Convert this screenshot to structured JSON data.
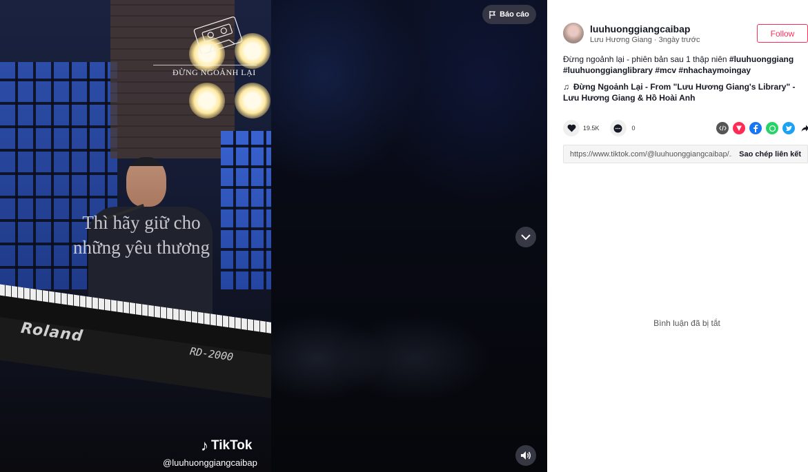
{
  "video": {
    "report_label": "Báo cáo",
    "song_logo_text": "ĐỪNG NGOẢNH LẠI",
    "lyric_line1": "Thì hãy giữ cho",
    "lyric_line2": "những yêu thương",
    "brand_keyboard": "Roland",
    "keyboard_model": "RD-2000",
    "watermark_brand": "TikTok",
    "watermark_handle": "@luuhuonggiangcaibap",
    "icons": [
      "flag-icon",
      "chevron-down-icon",
      "volume-icon",
      "tiktok-note-icon"
    ]
  },
  "author": {
    "username": "luuhuonggiangcaibap",
    "display_name": "Lưu Hương Giang",
    "separator": "·",
    "posted": "3ngày trước",
    "follow_label": "Follow"
  },
  "caption": {
    "text": "Đừng ngoảnh lại - phiên bản sau 1 thập niên ",
    "tags": [
      "#luuhuonggiang",
      "#luuhuonggianglibrary",
      "#mcv",
      "#nhachaymoingay"
    ]
  },
  "music": {
    "title": "Đừng Ngoảnh Lại - From \"Lưu Hương Giang's Library\" - Lưu Hương Giang & Hồ Hoài Anh"
  },
  "stats": {
    "likes": "19.5K",
    "comments": "0"
  },
  "share": {
    "icons": [
      "embed-icon",
      "send-icon",
      "facebook-icon",
      "whatsapp-icon",
      "twitter-icon",
      "share-arrow-icon"
    ]
  },
  "link": {
    "url": "https://www.tiktok.com/@luuhuonggiangcaibap/...",
    "copy_label": "Sao chép liên kết"
  },
  "comments": {
    "disabled_text": "Bình luận đã bị tắt"
  },
  "colors": {
    "accent": "#fe2c55",
    "text_primary": "#161823"
  }
}
